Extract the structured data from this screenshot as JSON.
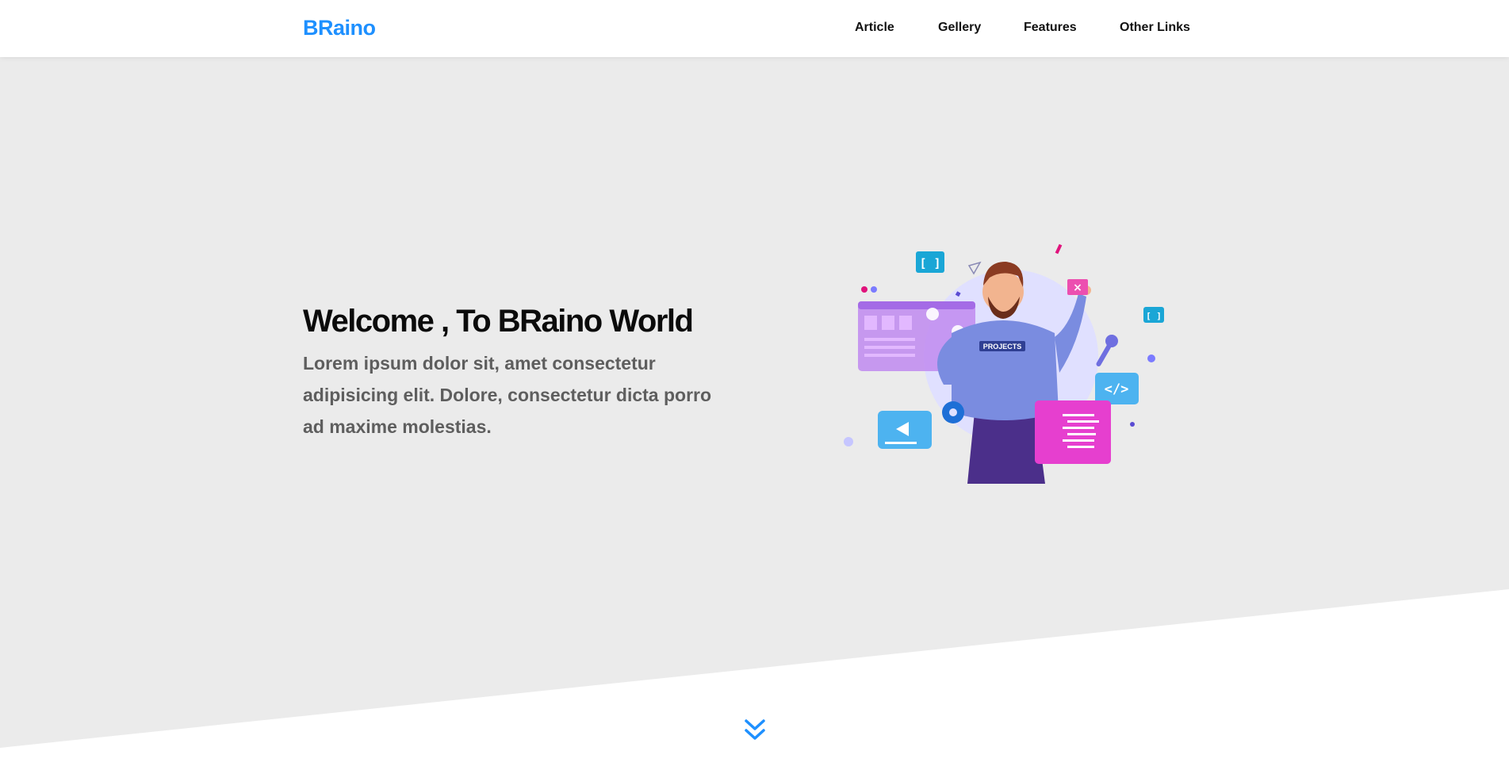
{
  "header": {
    "logo": "BRaino",
    "nav": [
      {
        "label": "Article"
      },
      {
        "label": "Gellery"
      },
      {
        "label": "Features"
      },
      {
        "label": "Other Links"
      }
    ]
  },
  "hero": {
    "title": "Welcome , To BRaino World",
    "text": "Lorem ipsum dolor sit, amet consectetur adipisicing elit. Dolore, consectetur dicta porro ad maxime molestias.",
    "illustration": {
      "shirt_text": "PROJECTS",
      "icons": [
        "brackets-icon",
        "close-icon",
        "code-icon",
        "play-icon",
        "gear-icon",
        "wrench-icon"
      ]
    },
    "scroll_icon": "double-chevron-down-icon"
  },
  "colors": {
    "accent": "#1e90ff",
    "hero_background": "#ebebeb",
    "title": "#0b0b0b",
    "body_text": "#5e5e5e"
  }
}
